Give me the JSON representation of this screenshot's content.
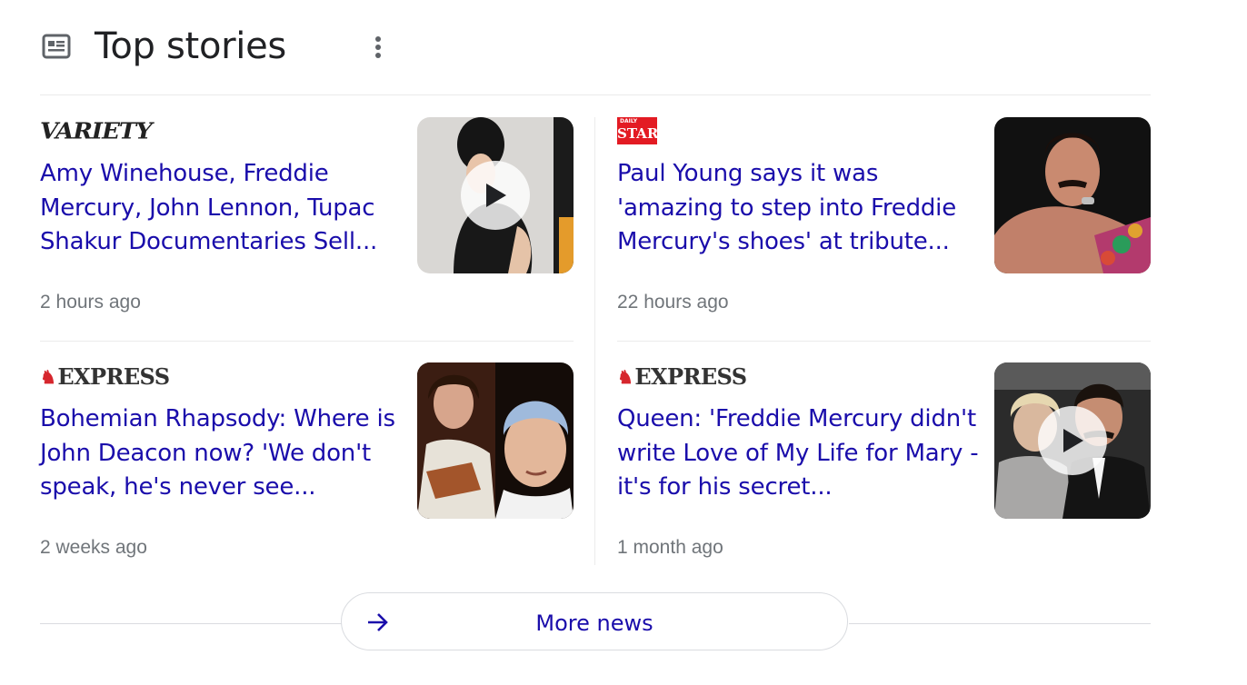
{
  "header": {
    "title": "Top stories",
    "icon": "newspaper-icon",
    "menu_icon": "more-vert-icon"
  },
  "stories": [
    {
      "source": "Variety",
      "logo_text": "VARIETY",
      "headline": "Amy Winehouse, Freddie Mercury, John Lennon, Tupac Shakur Documentaries Sell...",
      "time": "2 hours ago",
      "has_video": true
    },
    {
      "source": "Daily Star",
      "logo_text": "STAR",
      "logo_subtext": "DAILY",
      "headline": "Paul Young says it was 'amazing to step into Freddie Mercury's shoes' at tribute...",
      "time": "22 hours ago",
      "has_video": false
    },
    {
      "source": "Express",
      "logo_text": "EXPRESS",
      "headline": "Bohemian Rhapsody: Where is John Deacon now? 'We don't speak, he's never see...",
      "time": "2 weeks ago",
      "has_video": false
    },
    {
      "source": "Express",
      "logo_text": "EXPRESS",
      "headline": "Queen: 'Freddie Mercury didn't write Love of My Life for Mary - it's for his secret...",
      "time": "1 month ago",
      "has_video": true
    }
  ],
  "more_news": {
    "label": "More news",
    "icon": "arrow-right-icon"
  },
  "colors": {
    "link": "#1a0dab",
    "meta": "#70757a",
    "title": "#202124",
    "divider": "#ebebeb"
  }
}
